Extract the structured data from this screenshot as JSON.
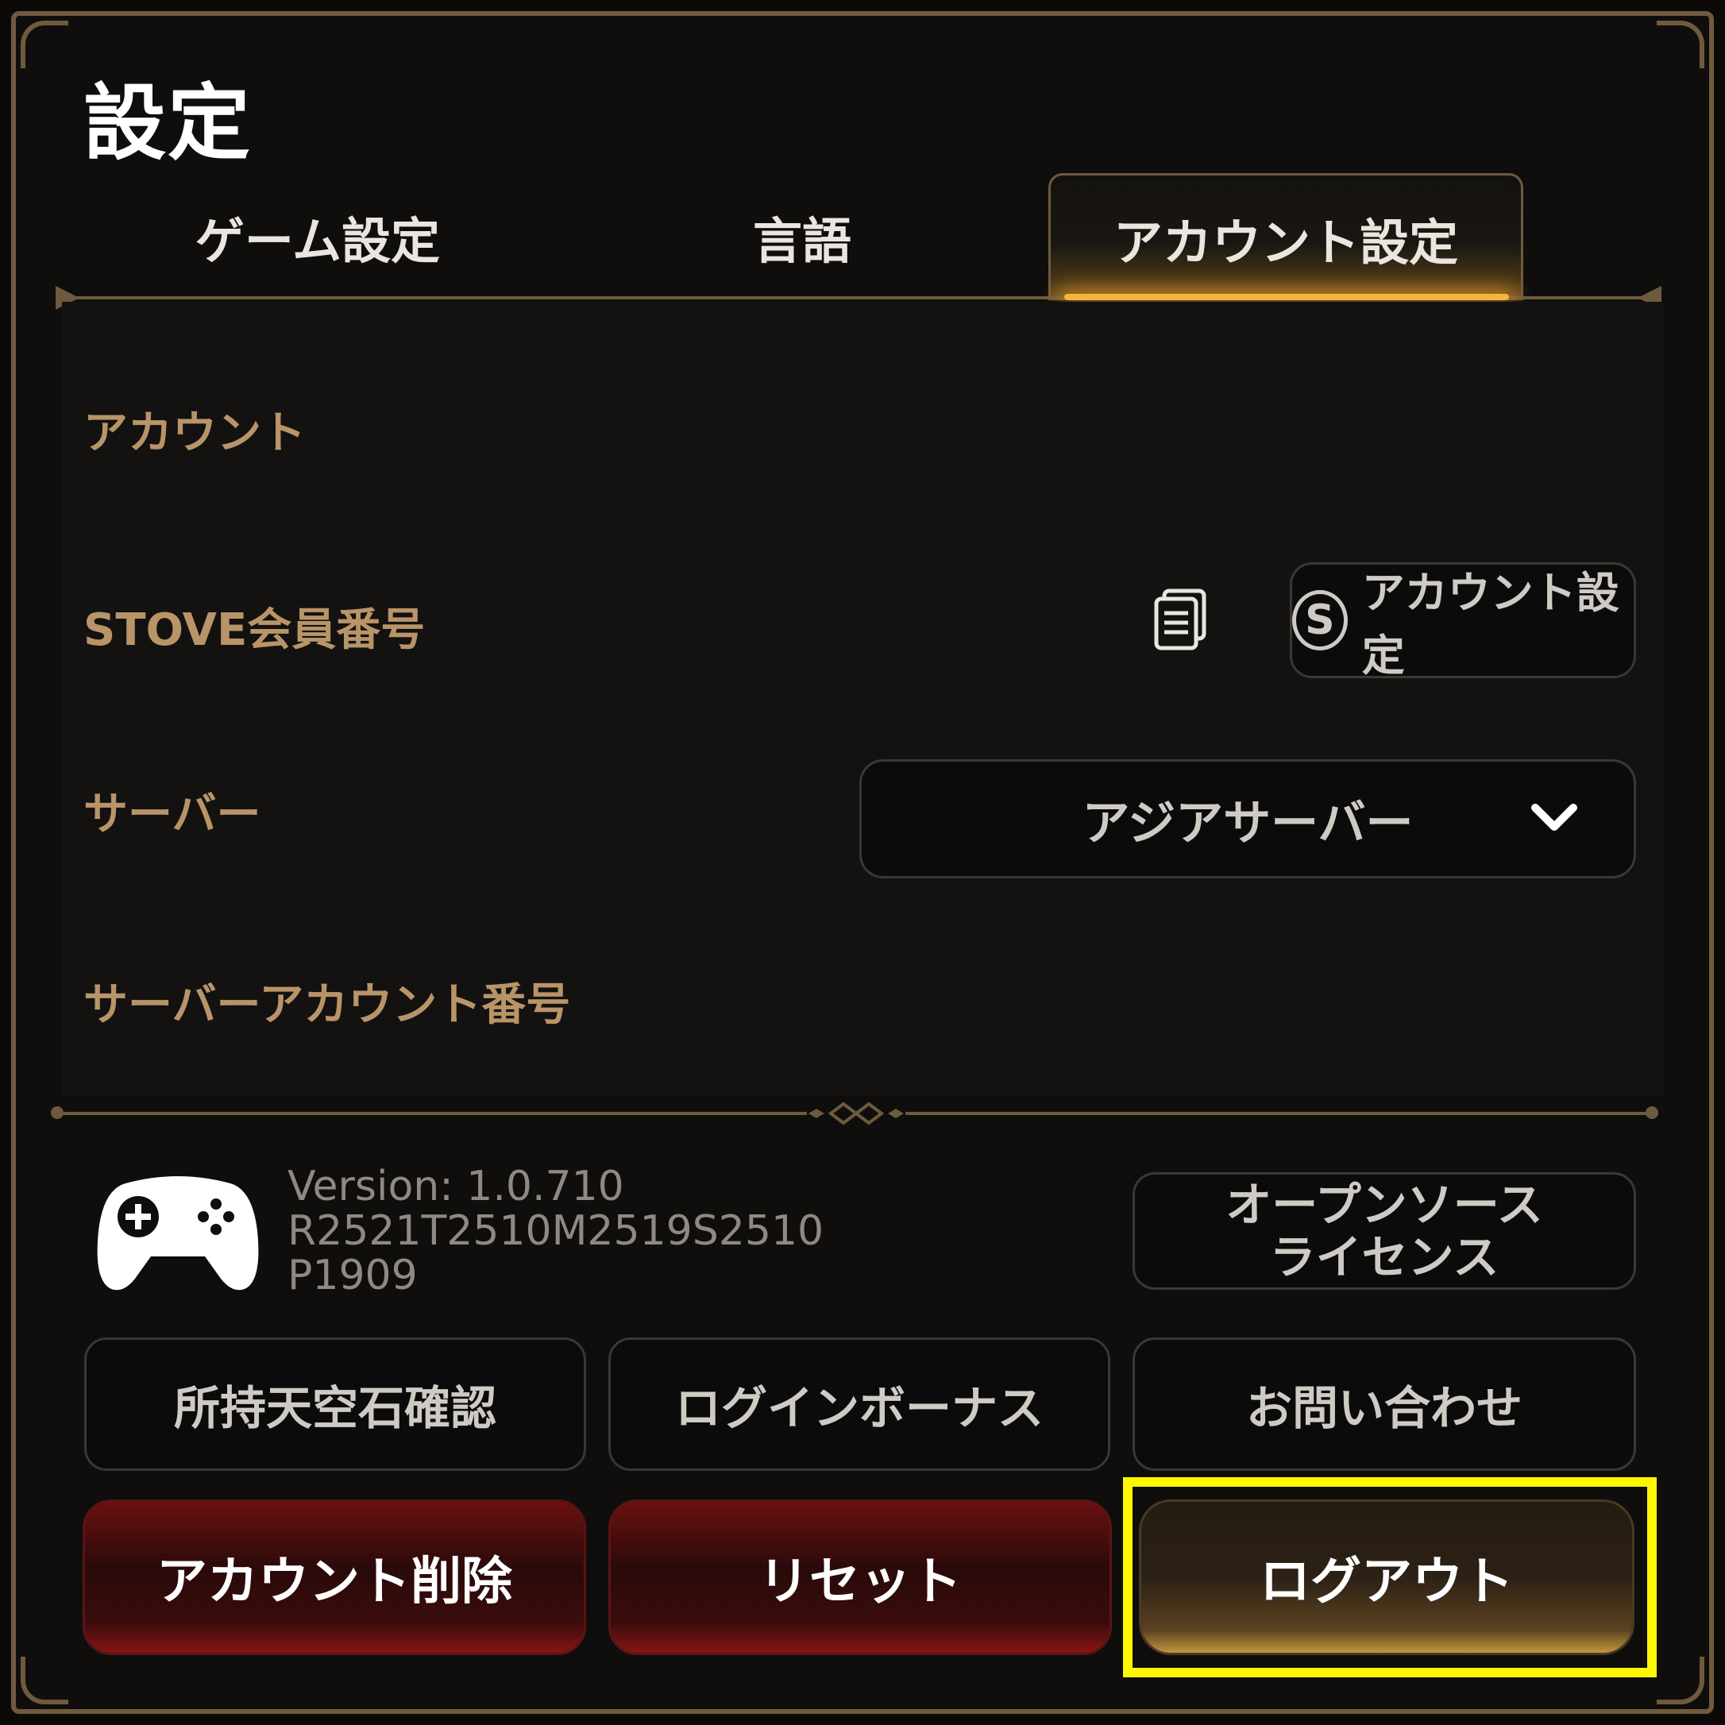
{
  "title": "設定",
  "tabs": {
    "game": "ゲーム設定",
    "language": "言語",
    "account": "アカウント設定",
    "active": "account"
  },
  "account_section": {
    "header": "アカウント",
    "stove_member_label": "STOVE会員番号",
    "stove_account_button": "アカウント設定",
    "stove_logo_letter": "S",
    "server_label": "サーバー",
    "server_selected": "アジアサーバー",
    "server_account_label": "サーバーアカウント番号"
  },
  "version_info": {
    "line1": "Version: 1.0.710",
    "line2": "R2521T2510M2519S2510",
    "line3": "P1909"
  },
  "buttons": {
    "license_line1": "オープンソース",
    "license_line2": "ライセンス",
    "check_stones": "所持天空石確認",
    "login_bonus": "ログインボーナス",
    "contact": "お問い合わせ",
    "delete_account": "アカウント削除",
    "reset": "リセット",
    "logout": "ログアウト"
  },
  "icons": {
    "copy": "copy-icon",
    "stove": "stove-logo-icon",
    "chevron": "chevron-down-icon",
    "gamepad": "gamepad-icon"
  },
  "colors": {
    "accent_gold": "#b89468",
    "frame": "#6e5a3e",
    "danger": "#6a1010",
    "highlight": "#fff700"
  }
}
